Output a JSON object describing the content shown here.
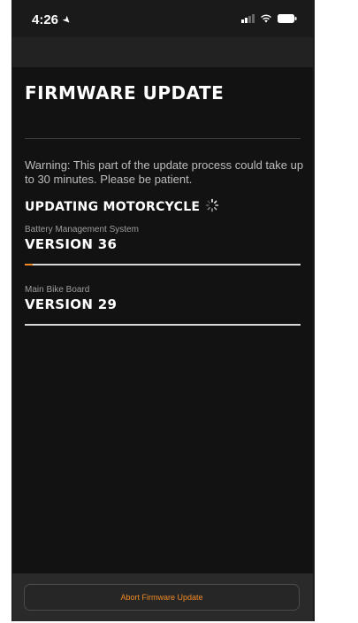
{
  "status_bar": {
    "time": "4:26",
    "location_icon": "location-arrow-icon",
    "signal_icon": "cellular-signal-icon",
    "wifi_icon": "wifi-icon",
    "battery_icon": "battery-icon"
  },
  "header": {
    "title": "FIRMWARE UPDATE"
  },
  "main": {
    "warning": "Warning: This part of the update process could take up to 30 minutes. Please be patient.",
    "updating_label": "UPDATING MOTORCYCLE",
    "spinner_icon": "loading-spinner-icon",
    "components": [
      {
        "name": "Battery Management System",
        "version": "VERSION 36",
        "progress": 0.03
      },
      {
        "name": "Main Bike Board",
        "version": "VERSION 29",
        "progress": 0
      }
    ]
  },
  "footer": {
    "abort_label": "Abort Firmware Update"
  },
  "colors": {
    "accent": "#f08a24",
    "background": "#121212",
    "text": "#ffffff",
    "muted_text": "#9e9e9e"
  }
}
